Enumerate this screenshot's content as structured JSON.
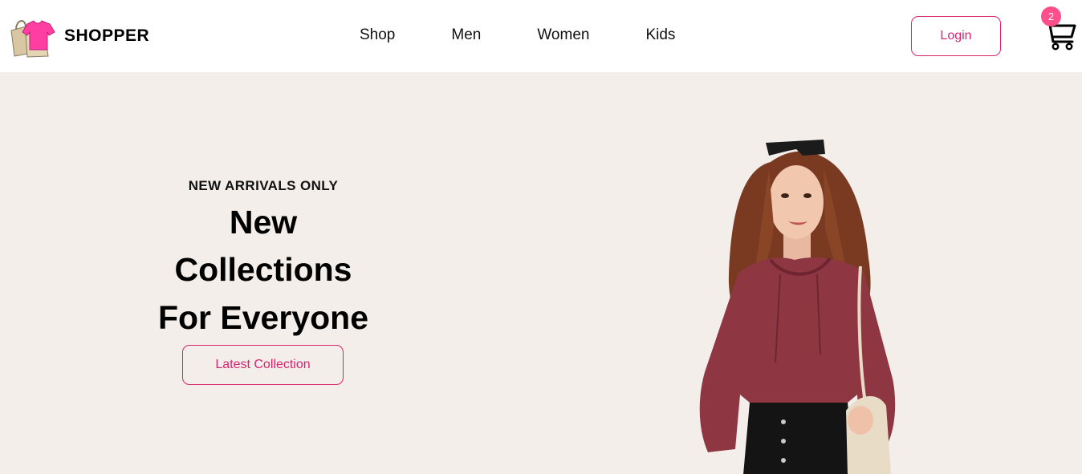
{
  "brand": {
    "name": "SHOPPER",
    "logo_icon": "shopping-bag-tshirt-icon"
  },
  "nav": {
    "items": [
      {
        "label": "Shop"
      },
      {
        "label": "Men"
      },
      {
        "label": "Women"
      },
      {
        "label": "Kids"
      }
    ],
    "login_label": "Login",
    "cart_icon": "cart-icon",
    "cart_count": "2"
  },
  "hero": {
    "eyebrow": "NEW ARRIVALS ONLY",
    "headline_lines": [
      "New",
      "Collections",
      "For Everyone"
    ],
    "cta_label": "Latest Collection",
    "image": "model-photo"
  },
  "colors": {
    "accent": "#d6246e",
    "badge": "#ff4f8b",
    "hero_bg": "#f3eee9"
  }
}
